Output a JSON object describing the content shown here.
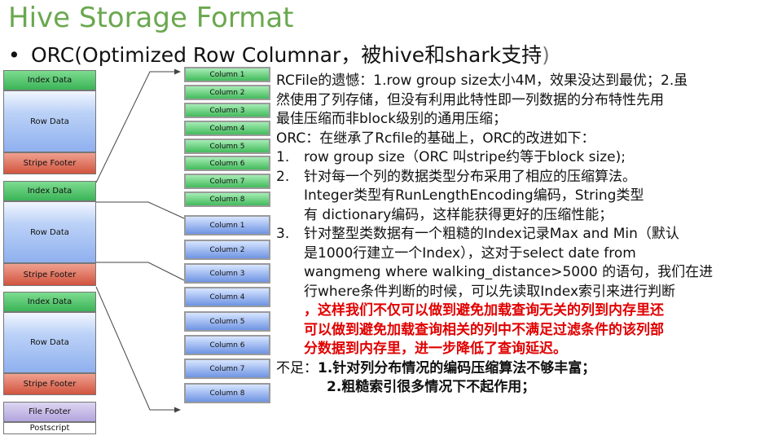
{
  "title": "Hive  Storage Format",
  "bullet": {
    "symbol": "•",
    "text": "ORC(Optimized Row Columnar，被hive和shark支持",
    "end": ")"
  },
  "file_blocks": {
    "index_data": "Index Data",
    "row_data": "Row Data",
    "stripe_footer": "Stripe Footer",
    "file_footer": "File Footer",
    "postscript": "Postscript"
  },
  "column_labels": [
    "Column 1",
    "Column 2",
    "Column 3",
    "Column 4",
    "Column 5",
    "Column 6",
    "Column 7",
    "Column 8"
  ],
  "colors": {
    "title": "#6aa84f",
    "highlight": "#e00000"
  },
  "text": {
    "p1a": "RCFile的遗憾：1.row group size太小4M，效果没达到最优；2.虽",
    "p1b": "然使用了列存储，但没有利用此特性即一列数据的分布特性先用",
    "p1c": "最佳压缩而非block级别的通用压缩；",
    "p2": "ORC：在继承了Rcfile的基础上，ORC的改进如下：",
    "i1_num": "1.",
    "i1": "row group size（ORC 叫stripe约等于block size);",
    "i2_num": "2.",
    "i2a": "针对每一个列的数据类型分布采用了相应的压缩算法。",
    "i2b": "Integer类型有RunLengthEncoding编码，String类型",
    "i2c": "有 dictionary编码，这样能获得更好的压缩性能；",
    "i3_num": "3.",
    "i3a": "针对整型类数据有一个粗糙的Index记录Max and Min（默认",
    "i3b": "是1000行建立一个Index），这对于select  date from",
    "i3c": "wangmeng where walking_distance>5000 的语句，我们在进",
    "i3d": "行where条件判断的时候，可以先读取Index索引来进行判断",
    "i3e": "，这样我们不仅可以做到避免加载查询无关的列到内存里还",
    "i3f": "可以做到避免加载查询相关的列中不满足过滤条件的该列部",
    "i3g": "分数据到内存里，进一步降低了查询延迟。",
    "d1_label": "不足：",
    "d1": "1.针对列分布情况的编码压缩算法不够丰富；",
    "d2": "2.粗糙索引很多情况下不起作用；"
  }
}
